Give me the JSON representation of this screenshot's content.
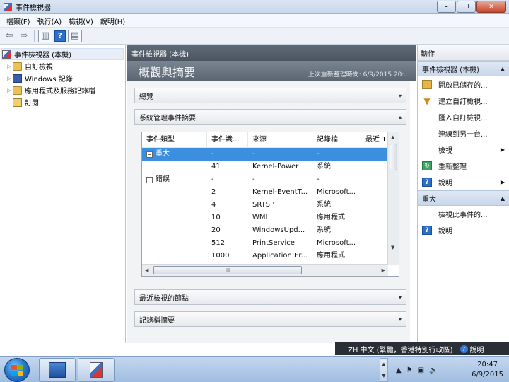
{
  "window": {
    "title": "事件檢視器"
  },
  "menu": [
    "檔案(F)",
    "執行(A)",
    "檢視(V)",
    "說明(H)"
  ],
  "tree": {
    "root": "事件檢視器 (本機)",
    "items": [
      {
        "label": "自訂檢視",
        "icon": "folder-icon",
        "expandable": true
      },
      {
        "label": "Windows 記錄",
        "icon": "logs-icon",
        "expandable": true
      },
      {
        "label": "應用程式及服務記錄檔",
        "icon": "folder-icon",
        "expandable": true
      },
      {
        "label": "訂閱",
        "icon": "subscription-icon",
        "expandable": false
      }
    ]
  },
  "middle": {
    "header": "事件檢視器 (本機)",
    "summary_title": "概觀與摘要",
    "last_refresh": "上次重新整理時間: 6/9/2015 20:...",
    "sections": {
      "overview": "總覽",
      "admin_events": "系統管理事件摘要",
      "recent_nodes": "最近檢視的節點",
      "log_summary": "記錄檔摘要"
    },
    "grid": {
      "columns": [
        "事件類型",
        "事件識...",
        "來源",
        "記錄檔",
        "最近 1"
      ],
      "rows": [
        {
          "type": "重大",
          "expander": "−",
          "id": "-",
          "source": "-",
          "log": "-",
          "selected": true
        },
        {
          "type": "",
          "id": "41",
          "source": "Kernel-Power",
          "log": "系統"
        },
        {
          "type": "錯誤",
          "expander": "−",
          "id": "-",
          "source": "-",
          "log": "-"
        },
        {
          "type": "",
          "id": "2",
          "source": "Kernel-EventT...",
          "log": "Microsoft..."
        },
        {
          "type": "",
          "id": "4",
          "source": "SRTSP",
          "log": "系統"
        },
        {
          "type": "",
          "id": "10",
          "source": "WMI",
          "log": "應用程式"
        },
        {
          "type": "",
          "id": "20",
          "source": "WindowsUpd...",
          "log": "系統"
        },
        {
          "type": "",
          "id": "512",
          "source": "PrintService",
          "log": "Microsoft..."
        },
        {
          "type": "",
          "id": "1000",
          "source": "Application Er...",
          "log": "應用程式"
        }
      ],
      "hscroll_grip": "III"
    }
  },
  "actions": {
    "header": "動作",
    "group1": "事件檢視器 (本機)",
    "group1_items": [
      {
        "label": "開啟已儲存的...",
        "icon": "open-folder-icon",
        "submenu": false
      },
      {
        "label": "建立自訂檢視...",
        "icon": "filter-icon",
        "submenu": false
      },
      {
        "label": "匯入自訂檢視...",
        "icon": "",
        "submenu": false
      },
      {
        "label": "連線到另一台...",
        "icon": "",
        "submenu": false
      },
      {
        "label": "檢視",
        "icon": "",
        "submenu": true
      },
      {
        "label": "重新整理",
        "icon": "refresh-icon",
        "submenu": false
      },
      {
        "label": "說明",
        "icon": "help-icon",
        "submenu": true
      }
    ],
    "group2": "重大",
    "group2_items": [
      {
        "label": "檢視此事件的...",
        "icon": ""
      },
      {
        "label": "說明",
        "icon": "help-icon"
      }
    ]
  },
  "ime": {
    "text": "ZH 中文 (繁體，香港特別行政區)",
    "help": "說明"
  },
  "taskbar": {
    "time": "20:47",
    "date": "6/9/2015"
  }
}
